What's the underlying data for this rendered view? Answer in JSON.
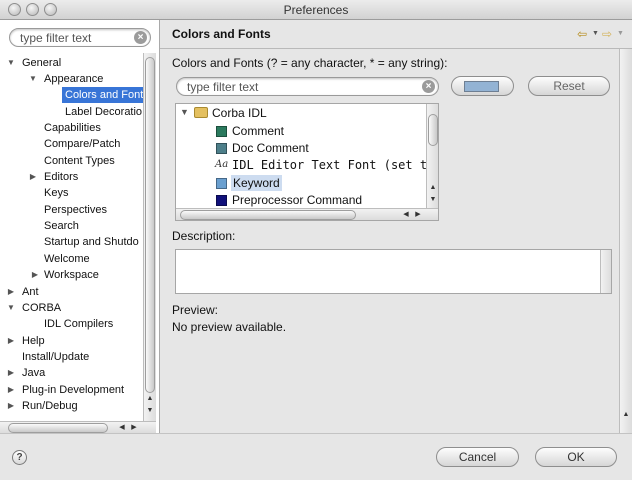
{
  "window": {
    "title": "Preferences"
  },
  "filter": {
    "placeholder": "type filter text"
  },
  "tree": {
    "items": [
      {
        "label": "General",
        "arrow": "▼"
      },
      {
        "label": "Appearance",
        "arrow": "▼"
      },
      {
        "label": "Colors and Font",
        "arrow": ""
      },
      {
        "label": "Label Decoratio",
        "arrow": ""
      },
      {
        "label": "Capabilities",
        "arrow": ""
      },
      {
        "label": "Compare/Patch",
        "arrow": ""
      },
      {
        "label": "Content Types",
        "arrow": ""
      },
      {
        "label": "Editors",
        "arrow": "▶"
      },
      {
        "label": "Keys",
        "arrow": ""
      },
      {
        "label": "Perspectives",
        "arrow": ""
      },
      {
        "label": "Search",
        "arrow": ""
      },
      {
        "label": "Startup and Shutdo",
        "arrow": ""
      },
      {
        "label": "Welcome",
        "arrow": ""
      },
      {
        "label": "Workspace",
        "arrow": "▶"
      },
      {
        "label": "Ant",
        "arrow": "▶"
      },
      {
        "label": "CORBA",
        "arrow": "▼"
      },
      {
        "label": "IDL Compilers",
        "arrow": ""
      },
      {
        "label": "Help",
        "arrow": "▶"
      },
      {
        "label": "Install/Update",
        "arrow": ""
      },
      {
        "label": "Java",
        "arrow": "▶"
      },
      {
        "label": "Plug-in Development",
        "arrow": "▶"
      },
      {
        "label": "Run/Debug",
        "arrow": "▶"
      }
    ]
  },
  "page": {
    "title": "Colors and Fonts",
    "nav_back": "⇦",
    "nav_fwd": "⇨",
    "instructions": "Colors and Fonts (? = any character, * = any string):",
    "filter_placeholder": "type filter text",
    "reset_label": "Reset",
    "swatch_color": "#93b3d4",
    "list": {
      "group": "Corba IDL",
      "items": [
        {
          "label": "Comment",
          "kind": "color",
          "color": "#2b7a5e"
        },
        {
          "label": "Doc Comment",
          "kind": "color",
          "color": "#4d7f8a"
        },
        {
          "label": "IDL Editor Text Font (set to",
          "kind": "font",
          "icon": "Aa"
        },
        {
          "label": "Keyword",
          "kind": "color",
          "color": "#6a9fcf"
        },
        {
          "label": "Preprocessor Command",
          "kind": "color",
          "color": "#10107a"
        }
      ]
    },
    "description_label": "Description:",
    "preview_label": "Preview:",
    "preview_text": "No preview available."
  },
  "buttons": {
    "cancel": "Cancel",
    "ok": "OK",
    "help": "?"
  }
}
